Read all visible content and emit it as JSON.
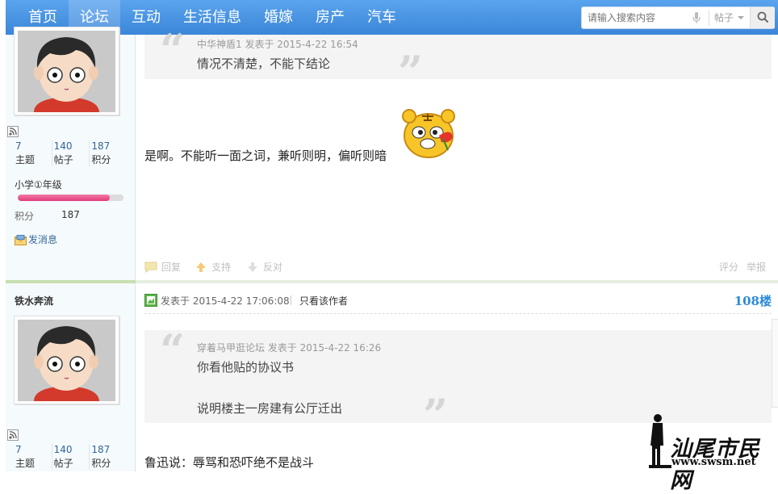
{
  "nav": {
    "items": [
      "首页",
      "论坛",
      "互动",
      "生活信息",
      "婚嫁",
      "房产",
      "汽车"
    ],
    "active": "论坛"
  },
  "search": {
    "placeholder": "请输入搜索内容",
    "scope": "帖子"
  },
  "post1": {
    "user": {
      "stats": [
        {
          "value": "7",
          "label": "主题"
        },
        {
          "value": "140",
          "label": "帖子"
        },
        {
          "value": "187",
          "label": "积分"
        }
      ],
      "grade": "小学①年级",
      "progress": 0.87,
      "points_label": "积分",
      "points_value": "187",
      "send_message": "发消息"
    },
    "quote": {
      "meta": "中华神盾1 发表于 2015-4-22 16:54",
      "lines": [
        "情况不清楚，不能下结论"
      ]
    },
    "body": "是啊。不能听一面之词，兼听则明，偏听则暗",
    "actions": {
      "reply": "回复",
      "support": "支持",
      "oppose": "反对",
      "rate": "评分",
      "report": "举报"
    }
  },
  "post2": {
    "username": "铁水奔流",
    "posted": "发表于 2015-4-22 17:06:08",
    "author_only": "只看该作者",
    "floor": "108楼",
    "user": {
      "stats": [
        {
          "value": "7",
          "label": "主题"
        },
        {
          "value": "140",
          "label": "帖子"
        },
        {
          "value": "187",
          "label": "积分"
        }
      ]
    },
    "quote": {
      "meta": "穿着马甲逛论坛 发表于 2015-4-22 16:26",
      "lines": [
        "你看他贴的协议书",
        "说明楼主一房建有公厅迁出"
      ]
    },
    "body": "鲁迅说：辱骂和恐吓绝不是战斗"
  },
  "watermark": {
    "text": "汕尾市民网",
    "url": "www.swsm.net"
  }
}
